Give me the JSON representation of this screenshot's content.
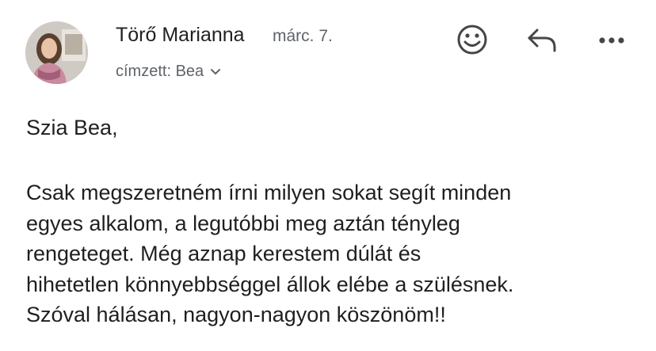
{
  "header": {
    "sender_name": "Törő Marianna",
    "date": "márc. 7.",
    "recipient": "címzett: Bea",
    "icons": [
      "avatar",
      "emoji-reaction-icon",
      "reply-icon",
      "more-options-icon",
      "chevron-down-icon"
    ]
  },
  "message": {
    "greeting": "Szia Bea,",
    "lines": [
      "Csak megszeretném írni milyen sokat segít minden",
      "egyes alkalom, a legutóbbi meg aztán tényleg",
      "rengeteget. Még aznap kerestem dúlát és",
      "hihetetlen könnyebbséggel állok elébe a szülésnek.",
      "Szóval hálásan, nagyon-nagyon köszönöm!!"
    ]
  },
  "colors": {
    "text": "#1f1f1f",
    "secondary": "#5f6368",
    "icon": "#444746"
  }
}
